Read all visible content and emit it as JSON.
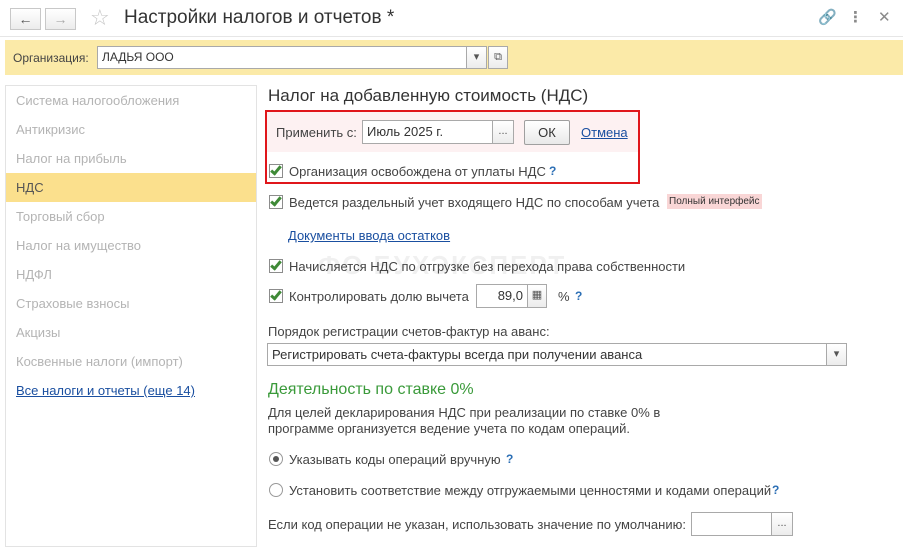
{
  "window": {
    "title": "Настройки налогов и отчетов *",
    "icons": [
      "back-arrow-icon",
      "forward-arrow-icon",
      "star-icon",
      "link-icon",
      "more-icon",
      "close-icon"
    ]
  },
  "org": {
    "label": "Организация:",
    "value": "ЛАДЬЯ ООО"
  },
  "sidebar": {
    "items": [
      {
        "label": "Система налогообложения"
      },
      {
        "label": "Антикризис"
      },
      {
        "label": "Налог на прибыль"
      },
      {
        "label": "НДС",
        "active": true
      },
      {
        "label": "Торговый сбор"
      },
      {
        "label": "Налог на имущество"
      },
      {
        "label": "НДФЛ"
      },
      {
        "label": "Страховые взносы"
      },
      {
        "label": "Акцизы"
      },
      {
        "label": "Косвенные налоги (импорт)"
      },
      {
        "label": "Все налоги и отчеты (еще 14)"
      }
    ]
  },
  "vat": {
    "heading": "Налог на добавленную стоимость (НДС)",
    "apply_label": "Применить с:",
    "apply_value": "Июль 2025 г.",
    "ok_label": "ОК",
    "cancel_label": "Отмена",
    "exempt_label": "Организация освобождена от уплаты НДС",
    "separate_label": "Ведется раздельный учет входящего НДС по способам учета",
    "full_interface_badge": "Полный интерфейс",
    "docs_link": "Документы ввода остатков",
    "shipment_label": "Начисляется НДС по отгрузке без перехода права собственности",
    "control_label": "Контролировать долю вычета",
    "control_value": "89,0",
    "percent_sign": "%",
    "help_mark": "?",
    "invoice_order_label": "Порядок регистрации счетов-фактур на аванс:",
    "invoice_order_value": "Регистрировать счета-фактуры всегда при получении аванса",
    "zero_rate_heading": "Деятельность по ставке 0%",
    "zero_rate_desc_1": "Для целей декларирования НДС при реализации по ставке 0% в",
    "zero_rate_desc_2": "программе организуется ведение учета по кодам операций.",
    "radio_manual": "Указывать коды операций вручную",
    "radio_auto": "Установить соответствие между отгружаемыми ценностями и кодами операций",
    "default_code_label": "Если код операции не указан, использовать значение по умолчанию:",
    "default_code_value": ""
  },
  "watermark": "ФО  БУХЭКСПЕРТ",
  "colors": {
    "org_bar": "#fbeaa8",
    "active_item": "#fbe08d",
    "highlight_border": "#e0161b",
    "check_green": "#3f8a37",
    "link_blue": "#1a4fa0",
    "zero_rate_green": "#3a9a3a"
  }
}
